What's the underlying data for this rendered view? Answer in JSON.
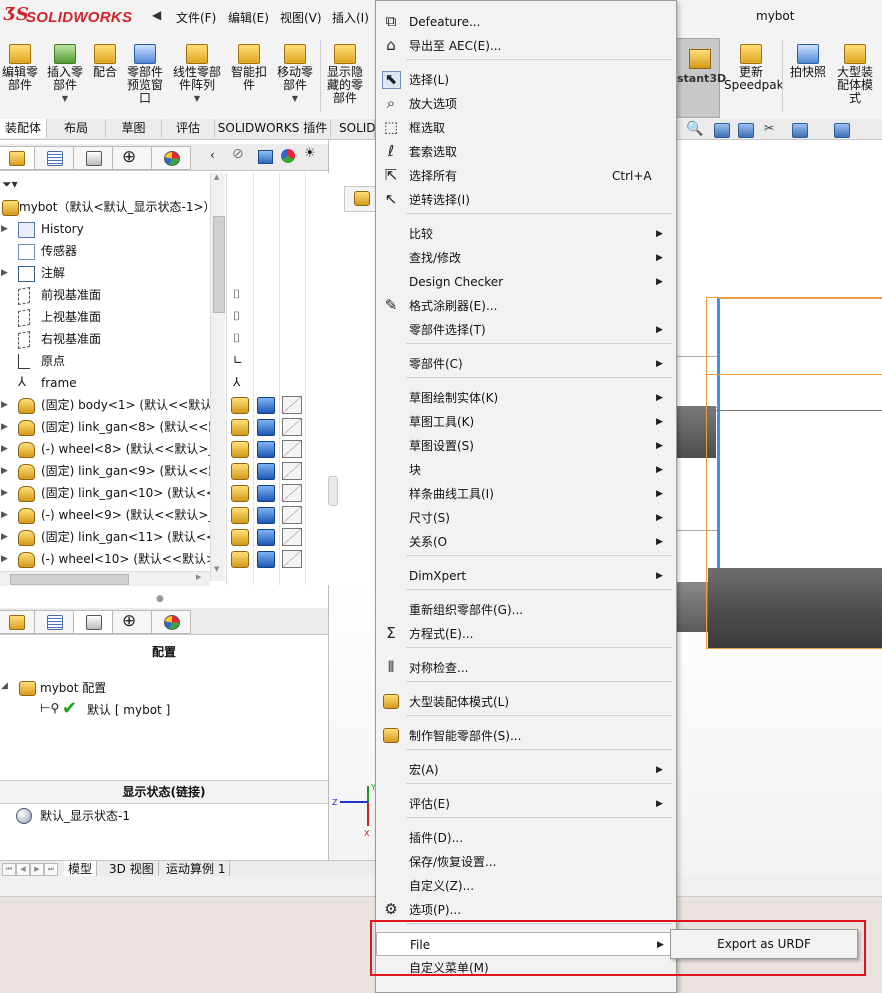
{
  "app": {
    "logo_text": "SOLIDWORKS",
    "window_title": "mybot"
  },
  "menubar": {
    "items": [
      "文件(F)",
      "编辑(E)",
      "视图(V)",
      "插入(I)"
    ]
  },
  "ribbon": {
    "buttons": [
      {
        "label": "编辑零\n部件",
        "icon": "edit-component-icon"
      },
      {
        "label": "插入零\n部件",
        "icon": "insert-component-icon",
        "dropdown": true
      },
      {
        "label": "配合",
        "icon": "mate-icon"
      },
      {
        "label": "零部件\n预览窗\n口",
        "icon": "component-preview-icon"
      },
      {
        "label": "线性零部\n件阵列",
        "icon": "linear-pattern-icon",
        "dropdown": true
      },
      {
        "label": "智能扣\n件",
        "icon": "smart-fastener-icon"
      },
      {
        "label": "移动零\n部件",
        "icon": "move-component-icon",
        "dropdown": true
      },
      {
        "label": "显示隐\n藏的零\n部件",
        "icon": "show-hidden-icon"
      },
      {
        "label": "stant3D",
        "icon": "instant3d-icon"
      },
      {
        "label": "更新\nSpeedpak",
        "icon": "speedpak-icon"
      },
      {
        "label": "拍快照",
        "icon": "snapshot-icon"
      },
      {
        "label": "大型装\n配体模\n式",
        "icon": "large-assembly-icon"
      }
    ]
  },
  "command_tabs": [
    "装配体",
    "布局",
    "草图",
    "评估",
    "SOLIDWORKS 插件",
    "SOLID"
  ],
  "feature_tree": {
    "root": "mybot（默认<默认_显示状态-1>）",
    "items": [
      {
        "label": "History",
        "icon": "history-icon",
        "expandable": true
      },
      {
        "label": "传感器",
        "icon": "sensor-icon",
        "expandable": false
      },
      {
        "label": "注解",
        "icon": "annotation-icon",
        "expandable": true
      },
      {
        "label": "前视基准面",
        "icon": "plane-icon",
        "expandable": false
      },
      {
        "label": "上视基准面",
        "icon": "plane-icon",
        "expandable": false
      },
      {
        "label": "右视基准面",
        "icon": "plane-icon",
        "expandable": false
      },
      {
        "label": "原点",
        "icon": "origin-icon",
        "expandable": false
      },
      {
        "label": "frame",
        "icon": "frame-icon",
        "expandable": false
      },
      {
        "label": "(固定) body<1> (默认<<默认",
        "icon": "part-icon",
        "expandable": true
      },
      {
        "label": "(固定) link_gan<8> (默认<<默",
        "icon": "part-icon",
        "expandable": true
      },
      {
        "label": "(-) wheel<8> (默认<<默认>_显",
        "icon": "part-icon",
        "expandable": true
      },
      {
        "label": "(固定) link_gan<9> (默认<<默",
        "icon": "part-icon",
        "expandable": true
      },
      {
        "label": "(固定) link_gan<10> (默认<<默",
        "icon": "part-icon",
        "expandable": true
      },
      {
        "label": "(-) wheel<9> (默认<<默认>_显",
        "icon": "part-icon",
        "expandable": true
      },
      {
        "label": "(固定) link_gan<11> (默认<<默",
        "icon": "part-icon",
        "expandable": true
      },
      {
        "label": "(-) wheel<10> (默认<<默认>_",
        "icon": "part-icon",
        "expandable": true
      }
    ]
  },
  "config_panel": {
    "title": "配置",
    "root": "mybot 配置",
    "child": "默认 [ mybot ]",
    "display_state_header": "显示状态(链接)",
    "display_state_item": "默认_显示状态-1"
  },
  "bottom_tabs": [
    "模型",
    "3D 视图",
    "运动算例 1"
  ],
  "context_menu": {
    "items": [
      {
        "label": "Defeature...",
        "icon": "defeature-icon",
        "arrow": false
      },
      {
        "label": "导出至 AEC(E)...",
        "icon": "aec-export-icon",
        "arrow": false
      },
      {
        "sep": true
      },
      {
        "label": "选择(L)",
        "icon": "select-cursor-icon",
        "arrow": false,
        "selected": true
      },
      {
        "label": "放大选项",
        "icon": "magnify-icon",
        "arrow": false
      },
      {
        "label": "框选取",
        "icon": "box-select-icon",
        "arrow": false
      },
      {
        "label": "套索选取",
        "icon": "lasso-icon",
        "arrow": false
      },
      {
        "label": "选择所有",
        "icon": "select-all-icon",
        "shortcut": "Ctrl+A",
        "arrow": false
      },
      {
        "label": "逆转选择(I)",
        "icon": "invert-select-icon",
        "arrow": false
      },
      {
        "sep": true
      },
      {
        "label": "比较",
        "icon": "",
        "arrow": true
      },
      {
        "label": "查找/修改",
        "icon": "",
        "arrow": true
      },
      {
        "label": "Design Checker",
        "icon": "",
        "arrow": true
      },
      {
        "label": "格式涂刷器(E)...",
        "icon": "format-painter-icon",
        "arrow": false
      },
      {
        "label": "零部件选择(T)",
        "icon": "",
        "arrow": true
      },
      {
        "sep": true
      },
      {
        "label": "零部件(C)",
        "icon": "",
        "arrow": true
      },
      {
        "sep": true
      },
      {
        "label": "草图绘制实体(K)",
        "icon": "",
        "arrow": true
      },
      {
        "label": "草图工具(K)",
        "icon": "",
        "arrow": true
      },
      {
        "label": "草图设置(S)",
        "icon": "",
        "arrow": true
      },
      {
        "label": "块",
        "icon": "",
        "arrow": true
      },
      {
        "label": "样条曲线工具(I)",
        "icon": "",
        "arrow": true
      },
      {
        "label": "尺寸(S)",
        "icon": "",
        "arrow": true
      },
      {
        "label": "关系(O",
        "icon": "",
        "arrow": true
      },
      {
        "sep": true
      },
      {
        "label": "DimXpert",
        "icon": "",
        "arrow": true
      },
      {
        "sep": true
      },
      {
        "label": "重新组织零部件(G)...",
        "icon": "",
        "arrow": false
      },
      {
        "label": "方程式(E)...",
        "icon": "sigma-icon",
        "arrow": false
      },
      {
        "sep": true
      },
      {
        "label": "对称检查...",
        "icon": "symmetry-check-icon",
        "arrow": false
      },
      {
        "sep": true
      },
      {
        "label": "大型装配体模式(L)",
        "icon": "large-assembly-icon",
        "arrow": false
      },
      {
        "sep": true
      },
      {
        "label": "制作智能零部件(S)...",
        "icon": "smart-component-icon",
        "arrow": false
      },
      {
        "sep": true
      },
      {
        "label": "宏(A)",
        "icon": "",
        "arrow": true
      },
      {
        "sep": true
      },
      {
        "label": "评估(E)",
        "icon": "",
        "arrow": true
      },
      {
        "sep": true
      },
      {
        "label": "插件(D)...",
        "icon": "",
        "arrow": false
      },
      {
        "label": "保存/恢复设置...",
        "icon": "",
        "arrow": false
      },
      {
        "label": "自定义(Z)...",
        "icon": "",
        "arrow": false
      },
      {
        "label": "选项(P)...",
        "icon": "gear-icon",
        "arrow": false
      },
      {
        "sep": true
      },
      {
        "label": "File",
        "icon": "",
        "arrow": true,
        "highlighted": true
      },
      {
        "label": "自定义菜单(M)",
        "icon": "",
        "arrow": false
      }
    ]
  },
  "submenu": {
    "items": [
      "Export as URDF"
    ]
  },
  "colors": {
    "brand_red": "#d2232a",
    "annotation_red": "#e0141e",
    "selection_blue": "#3e90e8",
    "bounding_orange": "#f09a3a"
  }
}
